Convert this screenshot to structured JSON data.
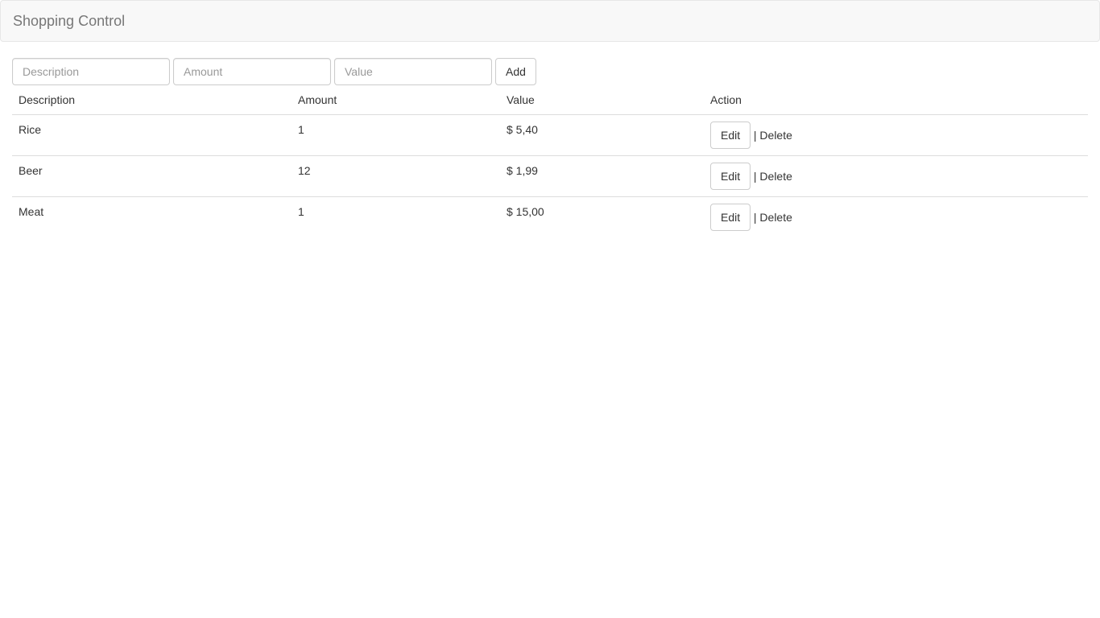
{
  "navbar": {
    "title": "Shopping Control"
  },
  "form": {
    "description_placeholder": "Description",
    "amount_placeholder": "Amount",
    "value_placeholder": "Value",
    "add_label": "Add"
  },
  "table": {
    "headers": [
      "Description",
      "Amount",
      "Value",
      "Action"
    ],
    "rows": [
      {
        "description": "Rice",
        "amount": "1",
        "value": "$ 5,40"
      },
      {
        "description": "Beer",
        "amount": "12",
        "value": "$ 1,99"
      },
      {
        "description": "Meat",
        "amount": "1",
        "value": "$ 15,00"
      }
    ],
    "edit_label": "Edit",
    "separator": "|",
    "delete_label": "Delete"
  }
}
